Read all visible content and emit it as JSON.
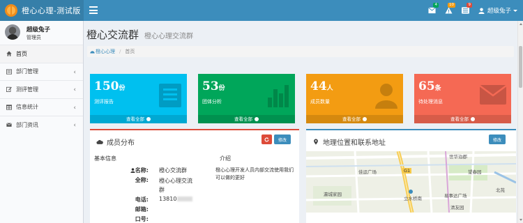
{
  "app": {
    "logo_text": "橙心心理-测试版"
  },
  "navbar": {
    "badges": [
      {
        "icon": "envelope-icon",
        "count": "4",
        "color": "#00a65a"
      },
      {
        "icon": "warning-icon",
        "count": "10",
        "color": "#f39c12"
      },
      {
        "icon": "tasks-icon",
        "count": "9",
        "color": "#dd4b39"
      }
    ],
    "user_name": "超级兔子"
  },
  "sidebar": {
    "user": {
      "name": "超级兔子",
      "role": "管理员"
    },
    "items": [
      {
        "label": "首页",
        "icon": "home-icon",
        "active": true,
        "has_children": false
      },
      {
        "label": "部门管理",
        "icon": "list-icon",
        "active": false,
        "has_children": true
      },
      {
        "label": "测评管理",
        "icon": "edit-icon",
        "active": false,
        "has_children": true
      },
      {
        "label": "信息统计",
        "icon": "table-icon",
        "active": false,
        "has_children": true
      },
      {
        "label": "部门资讯",
        "icon": "mail-icon",
        "active": false,
        "has_children": true
      }
    ]
  },
  "header": {
    "title": "橙心交流群",
    "subtitle": "橙心心理交流群"
  },
  "breadcrumb": {
    "root": "橙心心理",
    "current": "首页"
  },
  "stats": [
    {
      "number": "150",
      "unit": "份",
      "label": "测评报告",
      "footer": "查看全部",
      "color": "#00c0ef",
      "icon": "report-icon"
    },
    {
      "number": "53",
      "unit": "份",
      "label": "团体分析",
      "footer": "查看全部",
      "color": "#00a65a",
      "icon": "bar-chart-icon"
    },
    {
      "number": "44",
      "unit": "人",
      "label": "成员数量",
      "footer": "查看全部",
      "color": "#f39c12",
      "icon": "user-icon"
    },
    {
      "number": "65",
      "unit": "条",
      "label": "待处理消息",
      "footer": "查看全部",
      "color": "#f56954",
      "icon": "envelope-icon"
    }
  ],
  "member_box": {
    "title": "成员分布",
    "edit_label": "修改",
    "left_heading": "基本信息",
    "right_heading": "介绍",
    "name_label": "名称:",
    "name_value": "橙心交流群",
    "fullname_label": "全称:",
    "fullname_value_line1": "橙心心理交流",
    "fullname_value_line2": "群",
    "phone_label": "电话:",
    "phone_value": "13810",
    "email_label": "邮箱:",
    "door_label": "口号:",
    "intro": "橙心心理开发人员内部交流使用我们可以做的更好"
  },
  "map_box": {
    "title": "地理位置和联系地址",
    "edit_label": "修改",
    "labels": [
      "世华泊郡",
      "佳运广场",
      "望春园",
      "瀛城家园",
      "立水桥南",
      "易事达广场",
      "北苑",
      "清友园"
    ],
    "road_label": "G1"
  }
}
